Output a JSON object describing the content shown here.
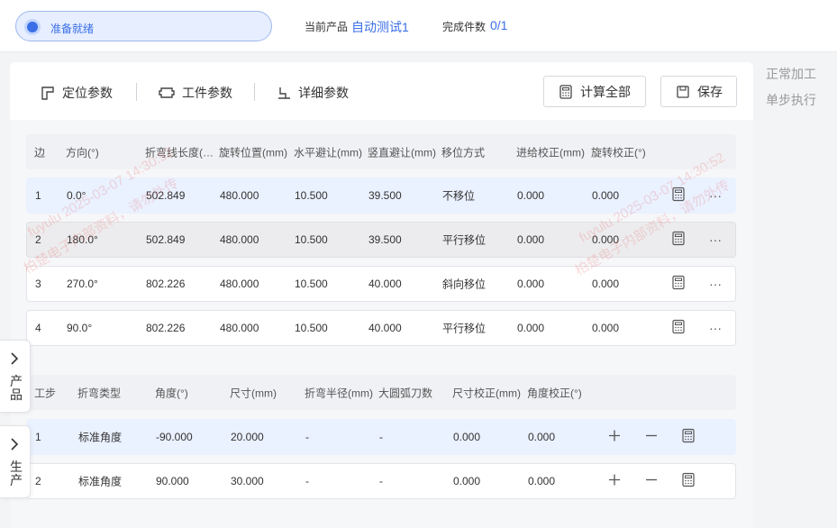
{
  "status": {
    "text": "准备就绪"
  },
  "product": {
    "label": "当前产品",
    "value": "自动测试1"
  },
  "count": {
    "label": "完成件数",
    "value": "0/1"
  },
  "modes": [
    "正常加工",
    "单步执行"
  ],
  "tabs": [
    "定位参数",
    "工件参数",
    "详细参数"
  ],
  "buttons": {
    "calc_all": "计算全部",
    "save": "保存"
  },
  "edges": {
    "headers": [
      "边",
      "方向(°)",
      "折弯线长度(mm)",
      "旋转位置(mm)",
      "水平避让(mm)",
      "竖直避让(mm)",
      "移位方式",
      "进给校正(mm)",
      "旋转校正(°)"
    ],
    "rows": [
      [
        "1",
        "0.0°",
        "502.849",
        "480.000",
        "10.500",
        "39.500",
        "不移位",
        "0.000",
        "0.000"
      ],
      [
        "2",
        "180.0°",
        "502.849",
        "480.000",
        "10.500",
        "39.500",
        "平行移位",
        "0.000",
        "0.000"
      ],
      [
        "3",
        "270.0°",
        "802.226",
        "480.000",
        "10.500",
        "40.000",
        "斜向移位",
        "0.000",
        "0.000"
      ],
      [
        "4",
        "90.0°",
        "802.226",
        "480.000",
        "10.500",
        "40.000",
        "平行移位",
        "0.000",
        "0.000"
      ]
    ]
  },
  "steps": {
    "headers": [
      "工步",
      "折弯类型",
      "角度(°)",
      "尺寸(mm)",
      "折弯半径(mm)",
      "大圆弧刀数",
      "尺寸校正(mm)",
      "角度校正(°)"
    ],
    "rows": [
      [
        "1",
        "标准角度",
        "-90.000",
        "20.000",
        "-",
        "-",
        "0.000",
        "0.000"
      ],
      [
        "2",
        "标准角度",
        "90.000",
        "30.000",
        "-",
        "-",
        "0.000",
        "0.000"
      ]
    ]
  },
  "side_tabs": [
    "产品",
    "生产"
  ],
  "more_label": "···",
  "watermark": {
    "line1": "fuyulu 2025-03-07 14:30:52",
    "line2": "柏楚电子内部资料，请勿外传"
  },
  "colors": {
    "accent": "#3b6fe8",
    "selected_row": "#eaf1ff"
  }
}
